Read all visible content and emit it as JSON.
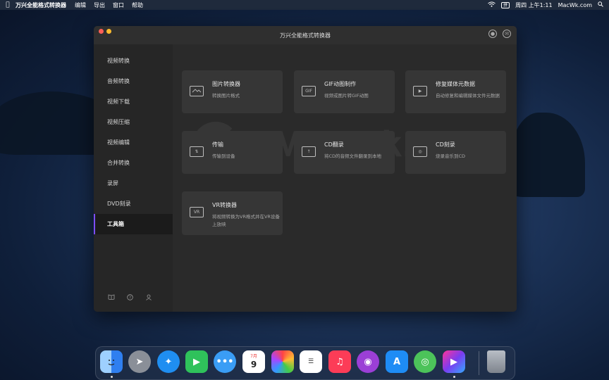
{
  "menubar": {
    "app_name": "万兴全能格式转换器",
    "menus": [
      "编辑",
      "导出",
      "窗口",
      "帮助"
    ],
    "clock": "周四 上午1:11",
    "site": "MacWk.com",
    "input_badge": "拼"
  },
  "window": {
    "title": "万兴全能格式转换器"
  },
  "sidebar": {
    "items": [
      {
        "label": "视频转换",
        "active": false
      },
      {
        "label": "音频转换",
        "active": false
      },
      {
        "label": "视频下载",
        "active": false
      },
      {
        "label": "视频压缩",
        "active": false
      },
      {
        "label": "视频编辑",
        "active": false
      },
      {
        "label": "合并转换",
        "active": false
      },
      {
        "label": "录屏",
        "active": false
      },
      {
        "label": "DVD刻录",
        "active": false
      },
      {
        "label": "工具箱",
        "active": true
      }
    ],
    "bottom_icons": [
      "book-icon",
      "help-icon",
      "users-icon"
    ]
  },
  "watermark": {
    "text": "MacWk.com"
  },
  "tools": [
    {
      "title": "图片转换器",
      "desc": "转换图片格式",
      "icon": "image-convert-icon"
    },
    {
      "title": "GIF动图制作",
      "desc": "视频或图片转GIF动图",
      "icon": "gif-icon"
    },
    {
      "title": "修复媒体元数据",
      "desc": "自动修复和编辑媒体文件元数据",
      "icon": "metadata-icon"
    },
    {
      "title": "传输",
      "desc": "传输到设备",
      "icon": "transfer-icon"
    },
    {
      "title": "CD翻录",
      "desc": "将CD的音频文件翻录到本地",
      "icon": "cd-rip-icon"
    },
    {
      "title": "CD刻录",
      "desc": "烧录音乐到CD",
      "icon": "cd-burn-icon"
    },
    {
      "title": "VR转换器",
      "desc": "将视频转换为VR格式并在VR设备上放映",
      "icon": "vr-icon"
    }
  ],
  "dock": {
    "apps": [
      "finder",
      "launchpad",
      "safari",
      "facetime",
      "messages",
      "calendar",
      "photos",
      "reminders",
      "music",
      "podcasts",
      "app-store",
      "maps",
      "uniconverter",
      "trash"
    ],
    "calendar_day": "9",
    "calendar_month": "7月",
    "colors": {
      "finder": "#3a8ef6",
      "launchpad": "#8a8f98",
      "safari": "#1f8ef1",
      "facetime": "#2fc25b",
      "messages": "#3a9df5",
      "calendar": "#ffffff",
      "photos": "#f4f4f4",
      "reminders": "#ffffff",
      "music": "#fc3c57",
      "podcasts": "#9b3fd6",
      "app-store": "#1e8cf5",
      "maps": "#4cc35a",
      "uniconverter": "#7b3cf0",
      "trash": "#9aa0a8"
    }
  }
}
